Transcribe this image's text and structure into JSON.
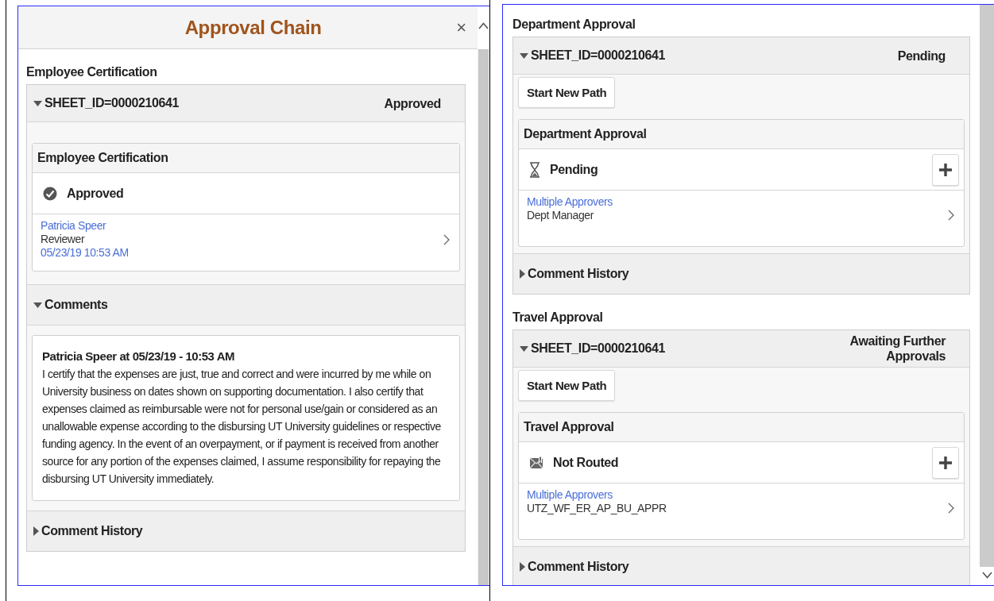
{
  "left_panel": {
    "title": "Approval Chain",
    "close_label": "×",
    "groups": [
      {
        "heading": "Employee Certification",
        "sheet_id": "SHEET_ID=0000210641",
        "expanded": true,
        "status": "Approved",
        "step": {
          "name": "Employee Certification",
          "kind": "approved",
          "state_label": "Approved",
          "can_add": false,
          "approver": [
            {
              "kind": "link",
              "text": "Patricia Speer"
            },
            {
              "kind": "text",
              "text": "Reviewer"
            },
            {
              "kind": "date",
              "text": "05/23/19 10:53 AM"
            }
          ]
        },
        "comments": {
          "label": "Comments",
          "expanded": true,
          "entries": [
            {
              "author_line": "Patricia Speer at 05/23/19 - 10:53 AM",
              "text": "I certify that the expenses are just, true and correct and were incurred by me while on University business on dates shown on supporting documentation. I also certify that expenses claimed as reimbursable were not for personal use/gain or considered as an unallowable expense according to the disbursing UT University guidelines or respective funding agency. In the event of an overpayment, or if payment is received from another source for any portion of the expenses claimed, I assume responsibility for repaying the disbursing UT University immediately."
            }
          ]
        },
        "comment_history": {
          "label": "Comment History",
          "expanded": false
        }
      }
    ]
  },
  "right_panel": {
    "groups": [
      {
        "heading": "Department Approval",
        "sheet_id": "SHEET_ID=0000210641",
        "expanded": true,
        "status": "Pending",
        "start_path_button": "Start New Path",
        "step": {
          "name": "Department Approval",
          "kind": "pending",
          "state_label": "Pending",
          "can_add": true,
          "approver": [
            {
              "kind": "link",
              "text": "Multiple Approvers"
            },
            {
              "kind": "text",
              "text": "Dept Manager"
            }
          ]
        },
        "comment_history": {
          "label": "Comment History",
          "expanded": false
        }
      },
      {
        "heading": "Travel Approval",
        "sheet_id": "SHEET_ID=0000210641",
        "expanded": true,
        "status": "Awaiting Further Approvals",
        "start_path_button": "Start New Path",
        "step": {
          "name": "Travel Approval",
          "kind": "not_routed",
          "state_label": "Not Routed",
          "can_add": true,
          "approver": [
            {
              "kind": "link",
              "text": "Multiple Approvers"
            },
            {
              "kind": "text",
              "text": "UTZ_WF_ER_AP_BU_APPR"
            }
          ]
        },
        "comment_history": {
          "label": "Comment History",
          "expanded": false
        }
      }
    ]
  }
}
